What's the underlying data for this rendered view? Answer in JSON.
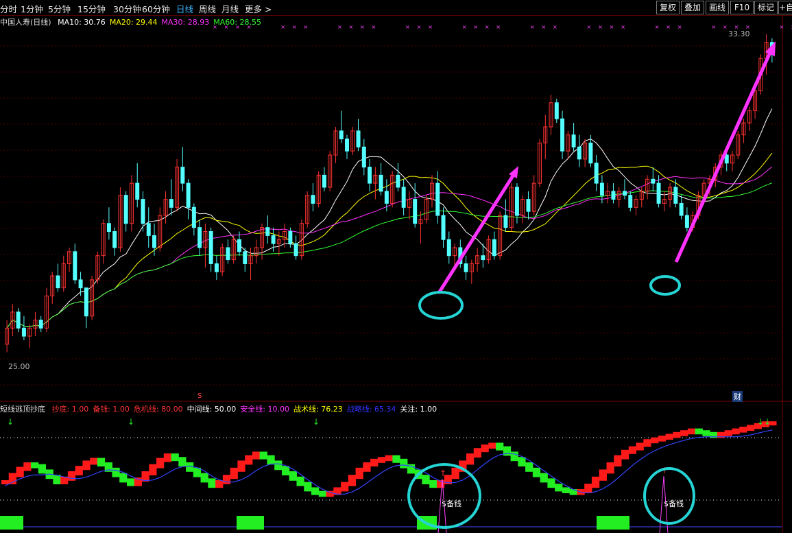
{
  "toolbar": {
    "tabs": [
      {
        "label": "分时",
        "active": false
      },
      {
        "label": "1分钟",
        "active": false
      },
      {
        "label": "5分钟",
        "active": false
      },
      {
        "label": "15分钟",
        "active": false
      },
      {
        "label": "30分钟",
        "active": false
      },
      {
        "label": "60分钟",
        "active": false
      },
      {
        "label": "日线",
        "active": true
      },
      {
        "label": "周线",
        "active": false
      },
      {
        "label": "月线",
        "active": false
      },
      {
        "label": "更多 >",
        "active": false
      }
    ],
    "buttons": [
      "复权",
      "叠加",
      "画线",
      "F10",
      "标记",
      "+自"
    ]
  },
  "main_legend": {
    "title": "中国人寿(日线)",
    "items": [
      {
        "label": "MA10:",
        "value": "30.76",
        "color": "#ffffff"
      },
      {
        "label": "MA20:",
        "value": "29.44",
        "color": "#ffff00"
      },
      {
        "label": "MA30:",
        "value": "28.93",
        "color": "#ff33ff"
      },
      {
        "label": "MA60:",
        "value": "28.55",
        "color": "#33ff33"
      }
    ]
  },
  "price_labels": {
    "high": "33.30",
    "low": "25.00"
  },
  "markers": {
    "s_marker": "S",
    "fin_marker": "财"
  },
  "sub_legend": {
    "title": "短线逃顶抄底",
    "items": [
      {
        "label": "抄底:",
        "value": "1.00",
        "color": "#ff3333"
      },
      {
        "label": "备钱:",
        "value": "1.00",
        "color": "#ff3333"
      },
      {
        "label": "危机线:",
        "value": "80.00",
        "color": "#ff3333"
      },
      {
        "label": "中间线:",
        "value": "50.00",
        "color": "#ffffff"
      },
      {
        "label": "安全线:",
        "value": "10.00",
        "color": "#ff33ff"
      },
      {
        "label": "战术线:",
        "value": "76.23",
        "color": "#ffff00"
      },
      {
        "label": "战略线:",
        "value": "65.34",
        "color": "#3333ff"
      },
      {
        "label": "关注:",
        "value": "1.00",
        "color": "#ffffff"
      }
    ]
  },
  "signal_labels": [
    "$备钱",
    "$备钱"
  ],
  "chart_data": {
    "type": "candlestick",
    "price_range": [
      25.0,
      33.3
    ],
    "candles": [
      [
        25.6,
        26.2,
        25.4,
        26.0
      ],
      [
        26.0,
        26.6,
        25.8,
        26.4
      ],
      [
        26.4,
        26.5,
        25.9,
        26.0
      ],
      [
        26.0,
        26.3,
        25.7,
        25.8
      ],
      [
        25.8,
        26.1,
        25.5,
        26.0
      ],
      [
        26.0,
        26.4,
        25.8,
        26.2
      ],
      [
        26.2,
        26.3,
        25.9,
        26.0
      ],
      [
        26.0,
        27.0,
        25.9,
        26.8
      ],
      [
        26.8,
        27.4,
        26.6,
        27.3
      ],
      [
        27.3,
        27.6,
        26.9,
        27.0
      ],
      [
        27.0,
        27.8,
        26.9,
        27.6
      ],
      [
        27.6,
        28.0,
        27.4,
        27.9
      ],
      [
        27.9,
        28.1,
        27.1,
        27.2
      ],
      [
        27.2,
        27.4,
        26.8,
        27.0
      ],
      [
        27.0,
        27.0,
        26.0,
        26.3
      ],
      [
        26.3,
        27.3,
        26.2,
        27.2
      ],
      [
        27.2,
        27.9,
        27.1,
        27.8
      ],
      [
        27.8,
        28.7,
        27.6,
        28.6
      ],
      [
        28.6,
        29.0,
        28.2,
        28.4
      ],
      [
        28.4,
        28.5,
        27.8,
        28.0
      ],
      [
        28.0,
        29.5,
        27.9,
        29.3
      ],
      [
        29.3,
        29.4,
        28.4,
        28.6
      ],
      [
        28.6,
        29.8,
        28.4,
        29.6
      ],
      [
        29.6,
        30.1,
        29.0,
        29.2
      ],
      [
        29.2,
        29.4,
        28.4,
        28.6
      ],
      [
        28.6,
        29.0,
        28.0,
        28.3
      ],
      [
        28.3,
        28.6,
        27.8,
        28.0
      ],
      [
        28.0,
        29.0,
        27.9,
        28.8
      ],
      [
        28.8,
        29.4,
        28.6,
        29.2
      ],
      [
        29.2,
        29.7,
        28.8,
        29.0
      ],
      [
        29.0,
        30.2,
        28.9,
        30.0
      ],
      [
        30.0,
        30.5,
        29.4,
        29.6
      ],
      [
        29.6,
        29.7,
        28.7,
        29.0
      ],
      [
        29.0,
        29.1,
        28.3,
        28.5
      ],
      [
        28.5,
        28.7,
        27.8,
        28.0
      ],
      [
        28.0,
        28.6,
        27.5,
        28.4
      ],
      [
        28.4,
        28.5,
        27.4,
        27.6
      ],
      [
        27.6,
        27.8,
        27.2,
        27.4
      ],
      [
        27.4,
        28.1,
        27.3,
        28.0
      ],
      [
        28.0,
        28.2,
        27.6,
        27.7
      ],
      [
        27.7,
        28.3,
        27.6,
        28.2
      ],
      [
        28.2,
        28.4,
        27.8,
        27.9
      ],
      [
        27.9,
        28.0,
        27.4,
        27.6
      ],
      [
        27.6,
        28.0,
        27.2,
        27.8
      ],
      [
        27.8,
        28.2,
        27.6,
        28.0
      ],
      [
        28.0,
        28.6,
        27.7,
        28.5
      ],
      [
        28.5,
        28.8,
        28.1,
        28.3
      ],
      [
        28.3,
        28.5,
        27.9,
        28.1
      ],
      [
        28.1,
        28.4,
        27.8,
        28.2
      ],
      [
        28.2,
        28.6,
        28.0,
        28.4
      ],
      [
        28.4,
        28.5,
        28.0,
        28.1
      ],
      [
        28.1,
        28.3,
        27.7,
        27.8
      ],
      [
        27.8,
        28.7,
        27.7,
        28.6
      ],
      [
        28.6,
        29.4,
        28.5,
        29.3
      ],
      [
        29.3,
        29.6,
        28.9,
        29.1
      ],
      [
        29.1,
        29.9,
        29.0,
        29.8
      ],
      [
        29.8,
        30.0,
        29.4,
        29.5
      ],
      [
        29.5,
        30.4,
        29.4,
        30.3
      ],
      [
        30.3,
        31.0,
        30.1,
        30.9
      ],
      [
        30.9,
        31.4,
        30.6,
        30.7
      ],
      [
        30.7,
        30.8,
        30.2,
        30.4
      ],
      [
        30.4,
        31.0,
        30.3,
        30.9
      ],
      [
        30.9,
        31.2,
        30.4,
        30.5
      ],
      [
        30.5,
        30.7,
        29.8,
        30.0
      ],
      [
        30.0,
        30.2,
        29.4,
        29.6
      ],
      [
        29.6,
        30.0,
        29.2,
        29.8
      ],
      [
        29.8,
        30.1,
        29.3,
        29.4
      ],
      [
        29.4,
        29.7,
        28.9,
        29.1
      ],
      [
        29.1,
        29.9,
        29.0,
        29.8
      ],
      [
        29.8,
        30.1,
        29.4,
        29.5
      ],
      [
        29.5,
        29.7,
        28.8,
        29.0
      ],
      [
        29.0,
        29.4,
        28.7,
        29.2
      ],
      [
        29.2,
        29.6,
        28.5,
        28.6
      ],
      [
        28.6,
        28.9,
        28.1,
        28.7
      ],
      [
        28.7,
        29.3,
        28.6,
        29.2
      ],
      [
        29.2,
        29.8,
        29.0,
        29.6
      ],
      [
        29.6,
        29.9,
        28.6,
        28.8
      ],
      [
        28.8,
        29.0,
        28.0,
        28.2
      ],
      [
        28.2,
        28.4,
        27.6,
        27.8
      ],
      [
        27.8,
        28.1,
        27.5,
        28.0
      ],
      [
        28.0,
        28.2,
        27.5,
        27.6
      ],
      [
        27.6,
        27.8,
        27.2,
        27.4
      ],
      [
        27.4,
        27.7,
        27.1,
        27.6
      ],
      [
        27.6,
        28.0,
        27.4,
        27.8
      ],
      [
        27.8,
        28.1,
        27.5,
        27.7
      ],
      [
        27.7,
        28.3,
        27.6,
        28.2
      ],
      [
        28.2,
        28.4,
        27.7,
        27.8
      ],
      [
        27.8,
        28.9,
        27.7,
        28.8
      ],
      [
        28.8,
        29.2,
        28.4,
        28.5
      ],
      [
        28.5,
        29.6,
        28.4,
        29.5
      ],
      [
        29.5,
        29.6,
        28.6,
        28.8
      ],
      [
        28.8,
        29.3,
        28.6,
        29.2
      ],
      [
        29.2,
        29.4,
        28.7,
        28.9
      ],
      [
        28.9,
        29.8,
        28.8,
        29.6
      ],
      [
        29.6,
        30.7,
        29.5,
        30.6
      ],
      [
        30.6,
        31.3,
        30.2,
        31.0
      ],
      [
        31.0,
        31.8,
        30.8,
        31.6
      ],
      [
        31.6,
        31.7,
        31.1,
        31.2
      ],
      [
        31.2,
        31.4,
        30.2,
        30.4
      ],
      [
        30.4,
        30.9,
        30.2,
        30.8
      ],
      [
        30.8,
        31.1,
        30.4,
        30.5
      ],
      [
        30.5,
        30.8,
        30.0,
        30.2
      ],
      [
        30.2,
        30.7,
        30.0,
        30.6
      ],
      [
        30.6,
        30.8,
        30.0,
        30.1
      ],
      [
        30.1,
        30.3,
        29.4,
        29.6
      ],
      [
        29.6,
        29.8,
        29.1,
        29.3
      ],
      [
        29.3,
        29.6,
        29.1,
        29.4
      ],
      [
        29.4,
        29.6,
        29.1,
        29.2
      ],
      [
        29.2,
        29.5,
        29.0,
        29.4
      ],
      [
        29.4,
        29.7,
        29.2,
        29.3
      ],
      [
        29.3,
        29.4,
        28.9,
        29.0
      ],
      [
        29.0,
        29.3,
        28.8,
        29.2
      ],
      [
        29.2,
        29.5,
        29.0,
        29.4
      ],
      [
        29.4,
        29.8,
        29.2,
        29.7
      ],
      [
        29.7,
        30.0,
        29.4,
        29.6
      ],
      [
        29.6,
        29.8,
        29.0,
        29.1
      ],
      [
        29.1,
        29.4,
        28.9,
        29.2
      ],
      [
        29.2,
        29.6,
        29.0,
        29.5
      ],
      [
        29.5,
        29.7,
        29.0,
        29.1
      ],
      [
        29.1,
        29.3,
        28.7,
        28.8
      ],
      [
        28.8,
        29.0,
        28.4,
        28.5
      ],
      [
        28.5,
        28.9,
        28.4,
        28.8
      ],
      [
        28.8,
        29.4,
        28.7,
        29.3
      ],
      [
        29.3,
        29.7,
        29.1,
        29.6
      ],
      [
        29.6,
        29.8,
        29.3,
        29.7
      ],
      [
        29.7,
        30.1,
        29.5,
        30.0
      ],
      [
        30.0,
        30.4,
        29.8,
        30.3
      ],
      [
        30.3,
        30.5,
        29.9,
        30.1
      ],
      [
        30.1,
        30.4,
        29.9,
        30.3
      ],
      [
        30.3,
        30.9,
        30.2,
        30.8
      ],
      [
        30.8,
        31.2,
        30.6,
        31.1
      ],
      [
        31.1,
        31.5,
        30.9,
        31.4
      ],
      [
        31.4,
        32.0,
        31.2,
        31.9
      ],
      [
        31.9,
        32.8,
        31.8,
        32.7
      ],
      [
        32.7,
        33.3,
        32.3,
        33.1
      ],
      [
        33.1,
        33.2,
        32.6,
        32.8
      ]
    ],
    "ma_series": [
      {
        "name": "MA10",
        "color": "#ffffff"
      },
      {
        "name": "MA20",
        "color": "#ffff00"
      },
      {
        "name": "MA30",
        "color": "#ff33ff"
      },
      {
        "name": "MA60",
        "color": "#33ff33"
      }
    ],
    "oscillator_range": [
      0,
      100
    ],
    "oscillator": [
      30,
      38,
      45,
      50,
      48,
      42,
      36,
      30,
      34,
      40,
      46,
      52,
      55,
      50,
      44,
      38,
      32,
      28,
      33,
      40,
      48,
      55,
      60,
      56,
      50,
      44,
      38,
      32,
      26,
      30,
      36,
      44,
      52,
      58,
      62,
      58,
      52,
      46,
      40,
      34,
      28,
      22,
      18,
      16,
      18,
      22,
      28,
      36,
      44,
      50,
      54,
      56,
      58,
      54,
      48,
      42,
      36,
      30,
      26,
      30,
      36,
      44,
      52,
      60,
      66,
      70,
      72,
      68,
      62,
      56,
      50,
      44,
      38,
      32,
      26,
      22,
      20,
      18,
      20,
      26,
      34,
      42,
      50,
      58,
      64,
      68,
      72,
      76,
      78,
      80,
      82,
      84,
      86,
      88,
      86,
      84,
      82,
      84,
      86,
      88,
      90,
      92,
      94,
      96,
      96
    ]
  }
}
